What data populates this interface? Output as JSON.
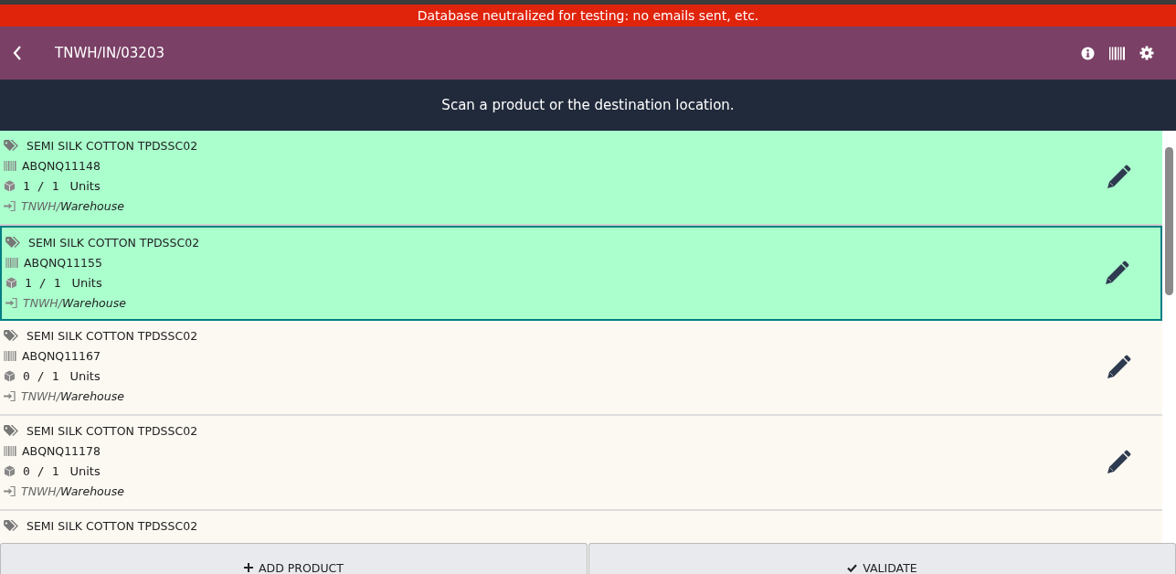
{
  "banner": "Database neutralized for testing: no emails sent, etc.",
  "header": {
    "title": "TNWH/IN/03203"
  },
  "message": "Scan a product or the destination location.",
  "lines": [
    {
      "product": "SEMI SILK COTTON TPDSSC02",
      "lot": "ABQNQ11148",
      "done": "1",
      "sep": "/",
      "demand": "1",
      "uom": "Units",
      "location_parent": "TNWH/",
      "location": "Warehouse",
      "complete": true,
      "selected": false
    },
    {
      "product": "SEMI SILK COTTON TPDSSC02",
      "lot": "ABQNQ11155",
      "done": "1",
      "sep": "/",
      "demand": "1",
      "uom": "Units",
      "location_parent": "TNWH/",
      "location": "Warehouse",
      "complete": true,
      "selected": true
    },
    {
      "product": "SEMI SILK COTTON TPDSSC02",
      "lot": "ABQNQ11167",
      "done": "0",
      "sep": "/",
      "demand": "1",
      "uom": "Units",
      "location_parent": "TNWH/",
      "location": "Warehouse",
      "complete": false,
      "selected": false
    },
    {
      "product": "SEMI SILK COTTON TPDSSC02",
      "lot": "ABQNQ11178",
      "done": "0",
      "sep": "/",
      "demand": "1",
      "uom": "Units",
      "location_parent": "TNWH/",
      "location": "Warehouse",
      "complete": false,
      "selected": false
    },
    {
      "product": "SEMI SILK COTTON TPDSSC02",
      "complete": false,
      "selected": false
    }
  ],
  "buttons": [
    {
      "kind": "add",
      "label": "ADD PRODUCT"
    },
    {
      "kind": "validate",
      "label": "VALIDATE"
    }
  ]
}
